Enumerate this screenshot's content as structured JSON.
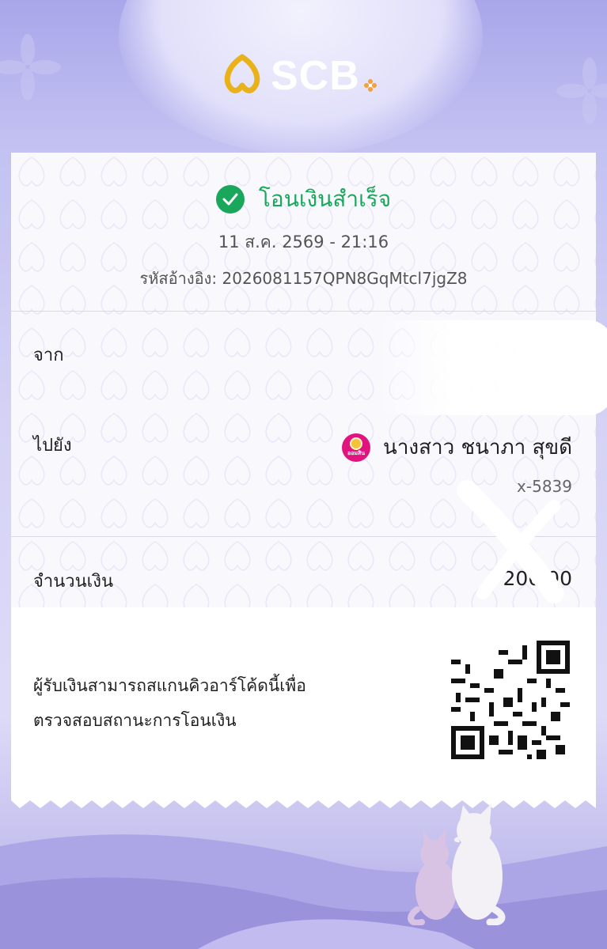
{
  "brand": {
    "logo_text": "SCB"
  },
  "receipt": {
    "status": "โอนเงินสำเร็จ",
    "datetime": "11 ส.ค. 2569 - 21:16",
    "reference_label": "รหัสอ้างอิง:",
    "reference_code": "2026081157QPN8GqMtcl7jgZ8",
    "from_label": "จาก",
    "to_label": "ไปยัง",
    "recipient_name": "นางสาว ชนาภา สุขดี",
    "recipient_bank_logo_text": "ออมสิน",
    "recipient_account": "x-5839",
    "amount_label": "จำนวนเงิน",
    "amount_value": "200.00",
    "qr_note_line1": "ผู้รับเงินสามารถสแกนคิวอาร์โค้ดนี้เพื่อ",
    "qr_note_line2": "ตรวจสอบสถานะการโอนเงิน"
  },
  "colors": {
    "success": "#1ba75b",
    "brand_gold": "#e9b21a",
    "bank_pink": "#e0137f",
    "background_lavender": "#c3c1f1"
  },
  "icons": [
    "scb-logo-icon",
    "success-check-icon",
    "gsb-bank-icon",
    "qr-code-icon"
  ]
}
